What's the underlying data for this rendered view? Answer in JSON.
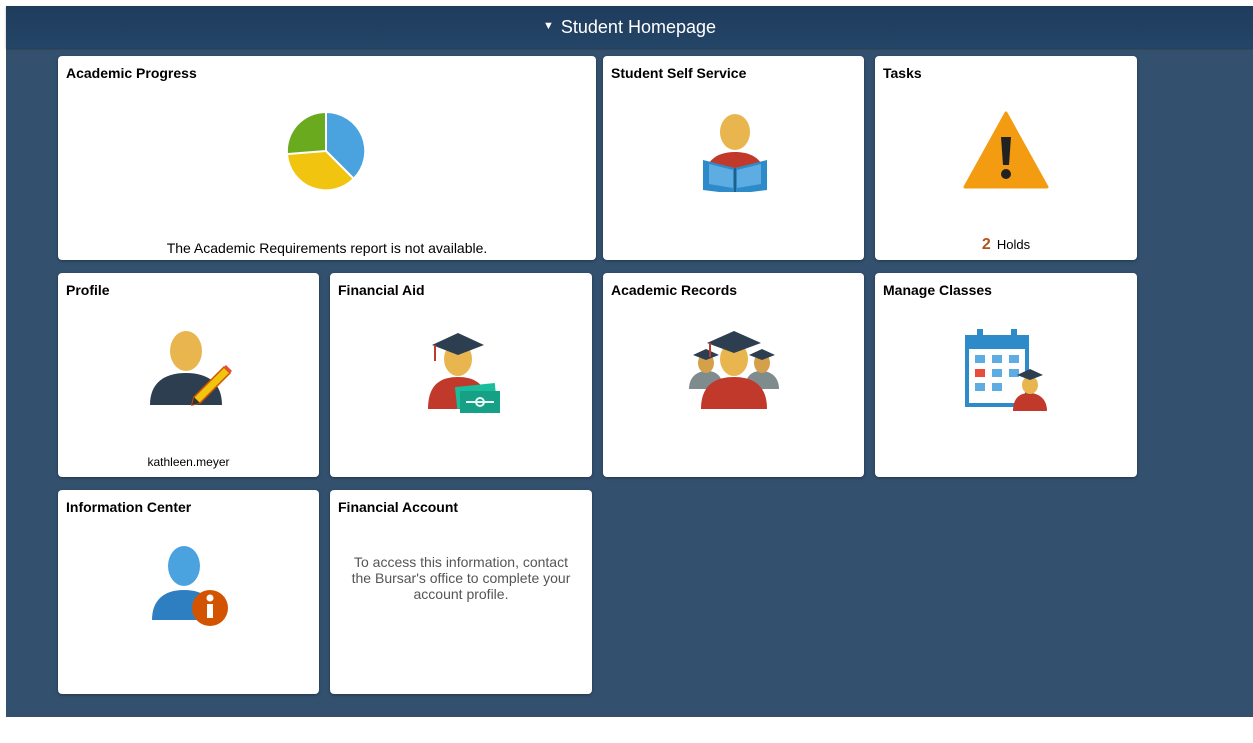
{
  "header": {
    "title": "Student Homepage",
    "caret_icon": "caret-down-icon"
  },
  "tiles": {
    "academic_progress": {
      "title": "Academic Progress",
      "message": "The Academic Requirements report is not available.",
      "icon": "pie-chart-icon"
    },
    "student_self_service": {
      "title": "Student Self Service",
      "icon": "student-reading-icon"
    },
    "tasks": {
      "title": "Tasks",
      "icon": "warning-icon",
      "holds_count": "2",
      "holds_label": "Holds"
    },
    "profile": {
      "title": "Profile",
      "icon": "profile-edit-icon",
      "username": "kathleen.meyer"
    },
    "financial_aid": {
      "title": "Financial Aid",
      "icon": "graduate-money-icon"
    },
    "academic_records": {
      "title": "Academic Records",
      "icon": "graduates-group-icon"
    },
    "manage_classes": {
      "title": "Manage Classes",
      "icon": "calendar-student-icon"
    },
    "information_center": {
      "title": "Information Center",
      "icon": "person-info-icon"
    },
    "financial_account": {
      "title": "Financial Account",
      "message_lines": [
        "To access this information, contact",
        "the Bursar's office to complete your",
        "account profile."
      ]
    }
  },
  "colors": {
    "page_bg": "#33516f",
    "banner_bg": "#244567",
    "tile_bg": "#ffffff",
    "holds_count": "#b0541b",
    "warning": "#f39c12",
    "skin": "#e8b54f",
    "red": "#c0392b",
    "blue": "#3498db"
  }
}
